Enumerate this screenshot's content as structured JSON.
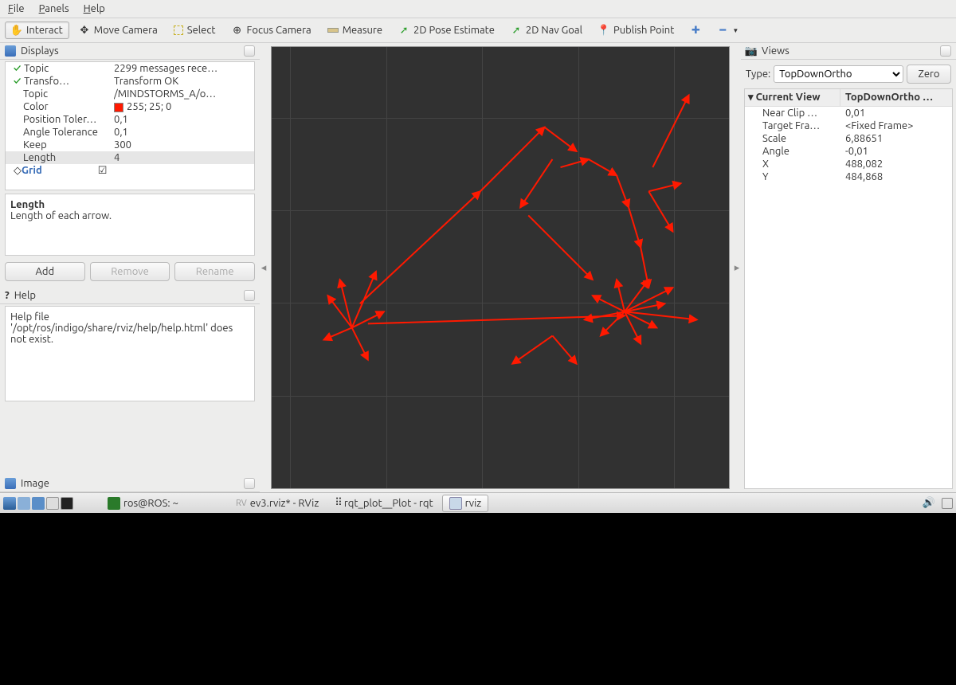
{
  "menubar": {
    "file": "File",
    "panels": "Panels",
    "help": "Help"
  },
  "toolbar": {
    "interact": "Interact",
    "move_camera": "Move Camera",
    "select": "Select",
    "focus_camera": "Focus Camera",
    "measure": "Measure",
    "pose_estimate": "2D Pose Estimate",
    "nav_goal": "2D Nav Goal",
    "publish_point": "Publish Point"
  },
  "displays": {
    "title": "Displays",
    "rows": [
      {
        "key": "Topic",
        "val": "2299 messages rece…",
        "check": true
      },
      {
        "key": "Transfo…",
        "val": "Transform OK",
        "check": true
      },
      {
        "key": "Topic",
        "val": "/MINDSTORMS_A/o…"
      },
      {
        "key": "Color",
        "val": "255; 25; 0",
        "swatch": "#ff1900"
      },
      {
        "key": "Position Toler…",
        "val": "0,1"
      },
      {
        "key": "Angle Tolerance",
        "val": "0,1"
      },
      {
        "key": "Keep",
        "val": "300"
      },
      {
        "key": "Length",
        "val": "4",
        "sel": true
      }
    ],
    "grid_label": "Grid",
    "desc_title": "Length",
    "desc_text": "Length of each arrow.",
    "add": "Add",
    "remove": "Remove",
    "rename": "Rename"
  },
  "help": {
    "title": "Help",
    "text": "Help file '/opt/ros/indigo/share/rviz/help/help.html' does not exist."
  },
  "image_panel": {
    "title": "Image"
  },
  "views": {
    "title": "Views",
    "type_label": "Type:",
    "type_value": "TopDownOrtho",
    "zero": "Zero",
    "current_view": "Current View",
    "current_type": "TopDownOrtho …",
    "rows": [
      {
        "k": "Near Clip …",
        "v": "0,01"
      },
      {
        "k": "Target Fra…",
        "v": "<Fixed Frame>"
      },
      {
        "k": "Scale",
        "v": "6,88651"
      },
      {
        "k": "Angle",
        "v": "-0,01"
      },
      {
        "k": "X",
        "v": "488,082"
      },
      {
        "k": "Y",
        "v": "484,868"
      }
    ]
  },
  "taskbar": {
    "terminal": "ros@ROS: ~",
    "rviz_file": "ev3.rviz* - RViz",
    "rqt": "rqt_plot__Plot - rqt",
    "rviz_win": "rviz"
  }
}
